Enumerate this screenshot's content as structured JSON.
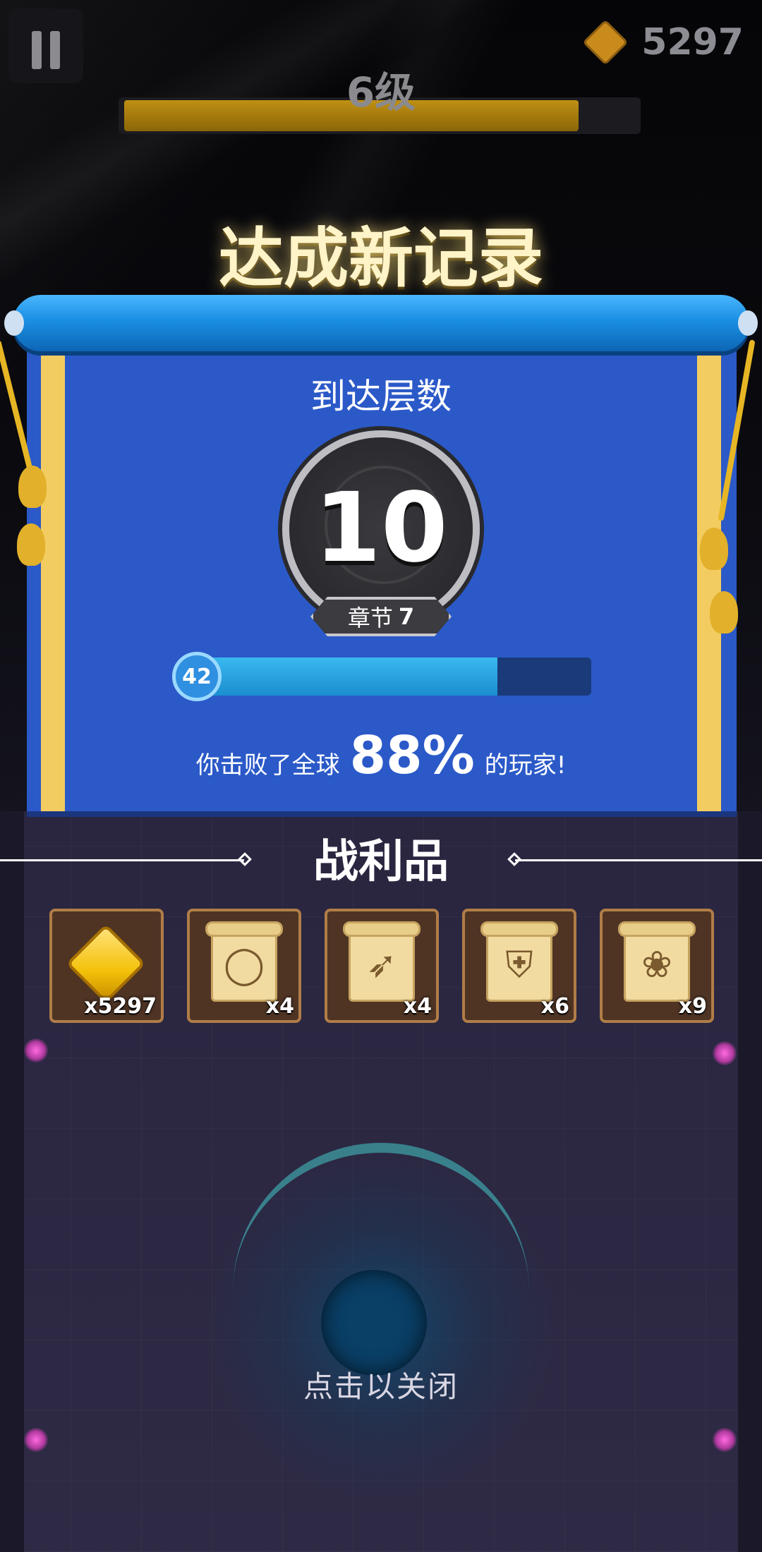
{
  "header": {
    "pause_icon": "pause-icon",
    "currency_icon": "bow-gem-icon",
    "currency_value": "5297",
    "level_label": "6级",
    "xp_progress": 0.89
  },
  "record_title": "达成新记录",
  "result": {
    "floors_label": "到达层数",
    "floor_value": "10",
    "chapter_label": "章节",
    "chapter_value": "7",
    "progress_badge": "42",
    "progress": 0.76,
    "beat_prefix": "你击败了全球",
    "beat_percent": "88%",
    "beat_suffix": "的玩家!"
  },
  "loot": {
    "title": "战利品",
    "items": [
      {
        "icon": "bow-gem-icon",
        "qty": "x5297"
      },
      {
        "icon": "ring-scroll-icon",
        "qty": "x4"
      },
      {
        "icon": "bow-scroll-icon",
        "qty": "x4"
      },
      {
        "icon": "armor-scroll-icon",
        "qty": "x6"
      },
      {
        "icon": "paw-scroll-icon",
        "qty": "x9"
      }
    ]
  },
  "close_hint": "点击以关闭",
  "colors": {
    "scroll_blue": "#2b59c8",
    "rod_blue": "#1a8fe2",
    "gold": "#f3cc61",
    "xp_gold": "#c09014"
  }
}
